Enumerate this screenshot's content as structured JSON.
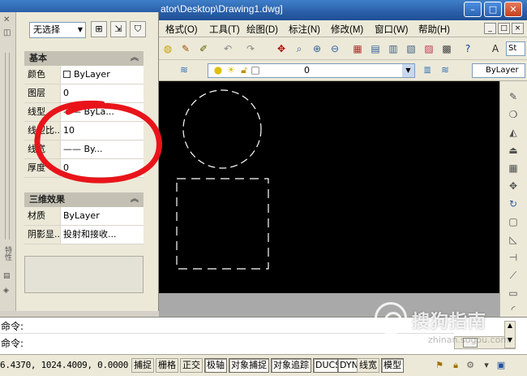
{
  "window": {
    "title": "ator\\Desktop\\Drawing1.dwg]",
    "min": "–",
    "max": "□",
    "close": "✕"
  },
  "menu": {
    "items": [
      "格式(O)",
      "工具(T)",
      "绘图(D)",
      "标注(N)",
      "修改(M)",
      "窗口(W)",
      "帮助(H)"
    ],
    "mdi": [
      "_",
      "□",
      "×"
    ]
  },
  "toolbar2": {
    "layer_value": "0",
    "bylayer": "ByLayer",
    "style_value": "St"
  },
  "palette": {
    "selection": "无选择",
    "sections": [
      {
        "title": "基本",
        "rows": [
          {
            "label": "颜色",
            "value": "ByLayer",
            "swatch": true
          },
          {
            "label": "图层",
            "value": "0"
          },
          {
            "label": "线型",
            "value": "—— ByLa..."
          },
          {
            "label": "线型比...",
            "value": "10"
          },
          {
            "label": "线宽",
            "value": "—— By..."
          },
          {
            "label": "厚度",
            "value": "0"
          }
        ]
      },
      {
        "title": "三维效果",
        "rows": [
          {
            "label": "材质",
            "value": "ByLayer"
          },
          {
            "label": "阴影显...",
            "value": "投射和接收..."
          }
        ]
      }
    ],
    "strip_label": "特性"
  },
  "command": {
    "line1": "命令:",
    "line2": "命令:"
  },
  "status": {
    "coords": "6.4370,  1024.4009, 0.0000",
    "buttons": [
      {
        "label": "捕捉",
        "on": false
      },
      {
        "label": "栅格",
        "on": false
      },
      {
        "label": "正交",
        "on": false
      },
      {
        "label": "极轴",
        "on": true
      },
      {
        "label": "对象捕捉",
        "on": true
      },
      {
        "label": "对象追踪",
        "on": true
      },
      {
        "label": "DUCS",
        "on": true
      },
      {
        "label": "DYN",
        "on": true
      },
      {
        "label": "线宽",
        "on": false
      },
      {
        "label": "模型",
        "on": true
      }
    ]
  },
  "watermark": {
    "text": "搜狗指南",
    "url": "zhinan.sogou.com"
  },
  "colors": {
    "annotation": "#e8141a",
    "canvas": "#000000",
    "titlebar": "#2a5fa8"
  }
}
